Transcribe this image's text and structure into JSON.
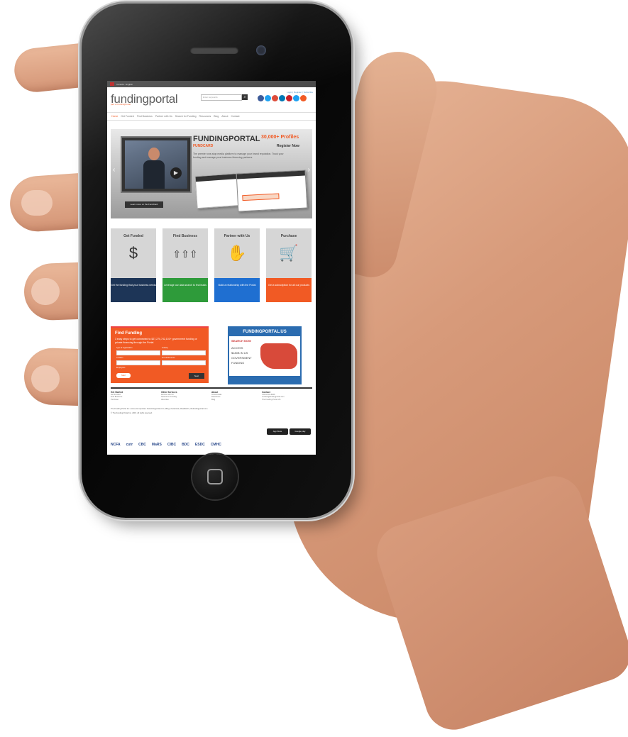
{
  "screen": {
    "topbar": {
      "language": "Canada · English"
    },
    "header": {
      "logo": "fundingportal",
      "logo_sub": "part of FundingPortal",
      "search_placeholder": "Enter keywords",
      "search_button": "⌕",
      "top_links": "Login | Register | Subscribe"
    },
    "social_colors": [
      "#3b5998",
      "#1da1f2",
      "#dd4b39",
      "#0077b5",
      "#cb2027",
      "#1da1f2",
      "#f15a24"
    ],
    "nav": {
      "items": [
        "Home",
        "Get Funded",
        "Find Business",
        "Partner with Us",
        "Search for Funding",
        "Resources",
        "Blog",
        "About",
        "Contact"
      ]
    },
    "hero": {
      "video_button": "▶",
      "brand": "FUNDINGPORTAL",
      "product": "FUNDCARD",
      "profiles": "30,000+ Profiles",
      "register": "Register Now",
      "description": "The premier one-stop media platform to manage your brand reputation. Track your funding and manage your business financing partners.",
      "cta": "Learn more on the FundCard",
      "prev": "‹",
      "next": "›"
    },
    "tiles": [
      {
        "title": "Get Funded",
        "icon": "$",
        "footer": "Get the funding that your business needs",
        "color": "#1d3557"
      },
      {
        "title": "Find Business",
        "icon": "⇧⇧⇧",
        "footer": "Leverage our data search to find leads",
        "color": "#2e9b3a"
      },
      {
        "title": "Partner with Us",
        "icon": "✋",
        "footer": "Build a relationship with the Portal",
        "color": "#1f6fd1"
      },
      {
        "title": "Purchase",
        "icon": "🛒",
        "footer": "Get a subscription for all our products",
        "color": "#f15a24"
      }
    ],
    "find_funding": {
      "title": "Find Funding",
      "description": "3 easy steps to get connected to $27,270,742,101+ government funding or private financing through the Portal.",
      "labels": [
        "Type of organization",
        "Industry",
        "Location",
        "Annual Revenue",
        "Employees"
      ],
      "start_label": "Start",
      "next_label": "Next"
    },
    "portal_us": {
      "title": "FUNDINGPORTAL.US",
      "search_now": "SEARCH NOW",
      "lines": [
        "ACCESS",
        "$180B IN US",
        "GOVERNMENT",
        "FUNDING"
      ]
    },
    "footer": {
      "columns": [
        {
          "heading": "Get Started",
          "items": [
            "Get Funded",
            "Find Business",
            "Purchase"
          ]
        },
        {
          "heading": "Other Services",
          "items": [
            "Partner with Us",
            "Search for Funding",
            "Advertise"
          ]
        },
        {
          "heading": "About",
          "items": [
            "Testimonials",
            "Resources",
            "Blog"
          ]
        },
        {
          "heading": "Contact",
          "items": [
            "1-844-404-5406",
            "contact@fundingportal.com",
            "The Funding Portal US"
          ]
        }
      ],
      "note": "The Funding Portal Inc. owns and operates: thefundingportal.com | Blog | Facebook | Readfetch | thefundingportal.com",
      "copyright": "© The Funding Portal Inc. 2015. All rights reserved.",
      "app_badges": [
        "App Store",
        "Google play"
      ],
      "partners": [
        "NCFA",
        "cutr",
        "CBC",
        "MaRS",
        "CIBC",
        "BDC",
        "ESDC",
        "CMHC"
      ]
    }
  }
}
